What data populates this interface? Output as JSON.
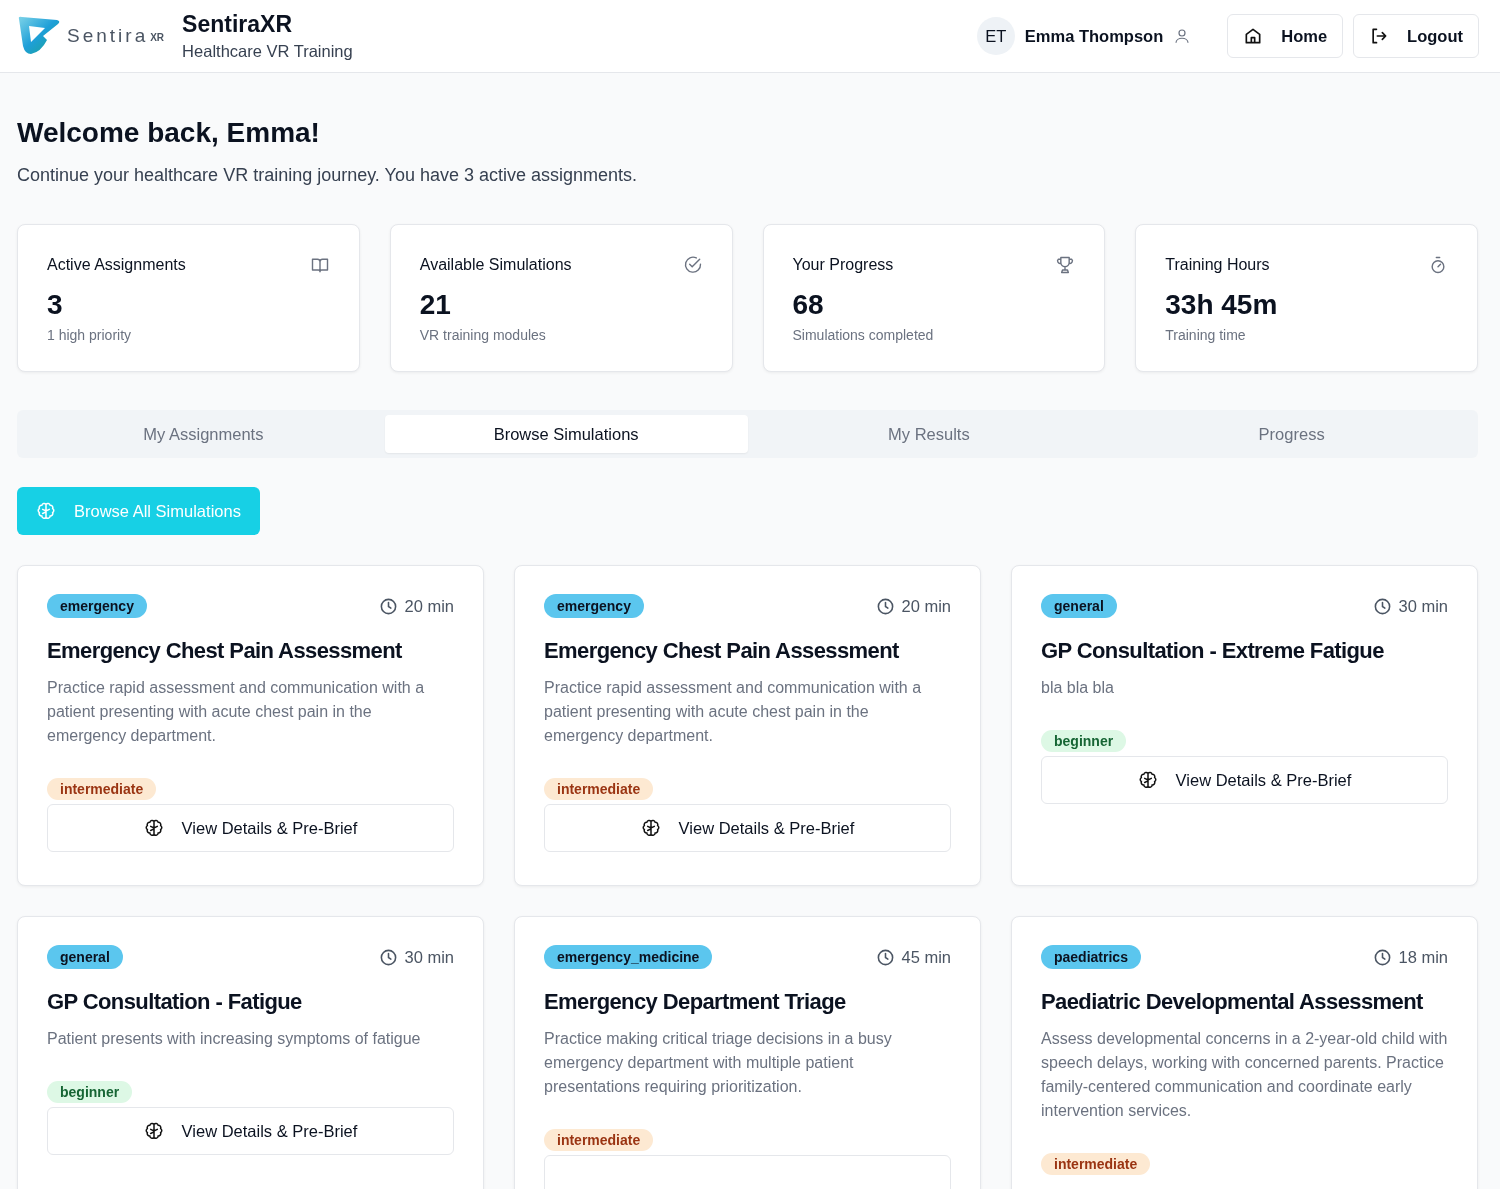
{
  "header": {
    "logo": {
      "wordmark": "Sentira",
      "superscript": "XR"
    },
    "app_name": "SentiraXR",
    "app_subtitle": "Healthcare VR Training",
    "user": {
      "initials": "ET",
      "name": "Emma Thompson"
    },
    "buttons": [
      {
        "kind": "home",
        "label": "Home"
      },
      {
        "kind": "logout",
        "label": "Logout"
      }
    ]
  },
  "welcome": {
    "title": "Welcome back, Emma!",
    "subtitle": "Continue your healthcare VR training journey. You have 3 active assignments."
  },
  "stats": [
    {
      "kind": "book",
      "title": "Active Assignments",
      "value": "3",
      "note": "1 high priority"
    },
    {
      "kind": "check",
      "title": "Available Simulations",
      "value": "21",
      "note": "VR training modules"
    },
    {
      "kind": "trophy",
      "title": "Your Progress",
      "value": "68",
      "note": "Simulations completed"
    },
    {
      "kind": "timer",
      "title": "Training Hours",
      "value": "33h 45m",
      "note": "Training time"
    }
  ],
  "tabs": [
    {
      "label": "My Assignments",
      "selected": false
    },
    {
      "label": "Browse Simulations",
      "selected": true
    },
    {
      "label": "My Results",
      "selected": false
    },
    {
      "label": "Progress",
      "selected": false
    }
  ],
  "browse_button": "Browse All Simulations",
  "simulations": [
    {
      "category": "emergency",
      "duration": "20 min",
      "title": "Emergency Chest Pain Assessment",
      "description": "Practice rapid assessment and communication with a patient presenting with acute chest pain in the emergency department.",
      "difficulty": {
        "label": "intermediate",
        "kind": "medium"
      },
      "button": "View Details & Pre-Brief"
    },
    {
      "category": "emergency",
      "duration": "20 min",
      "title": "Emergency Chest Pain Assessment",
      "description": "Practice rapid assessment and communication with a patient presenting with acute chest pain in the emergency department.",
      "difficulty": {
        "label": "intermediate",
        "kind": "medium"
      },
      "button": "View Details & Pre-Brief"
    },
    {
      "category": "general",
      "duration": "30 min",
      "title": "GP Consultation - Extreme Fatigue",
      "description": "bla bla bla",
      "difficulty": {
        "label": "beginner",
        "kind": "easy"
      },
      "button": "View Details & Pre-Brief"
    },
    {
      "category": "general",
      "duration": "30 min",
      "title": "GP Consultation - Fatigue",
      "description": "Patient presents with increasing symptoms of fatigue",
      "difficulty": {
        "label": "beginner",
        "kind": "easy"
      },
      "button": "View Details & Pre-Brief"
    },
    {
      "category": "emergency_medicine",
      "duration": "45 min",
      "title": "Emergency Department Triage",
      "description": "Practice making critical triage decisions in a busy emergency department with multiple patient presentations requiring prioritization.",
      "difficulty": {
        "label": "intermediate",
        "kind": "medium"
      },
      "button_cut": true
    },
    {
      "category": "paediatrics",
      "duration": "18 min",
      "title": "Paediatric Developmental Assessment",
      "description": "Assess developmental concerns in a 2-year-old child with speech delays, working with concerned parents. Practice family-centered communication and coordinate early intervention services.",
      "difficulty": {
        "label": "intermediate",
        "kind": "medium"
      }
    }
  ]
}
